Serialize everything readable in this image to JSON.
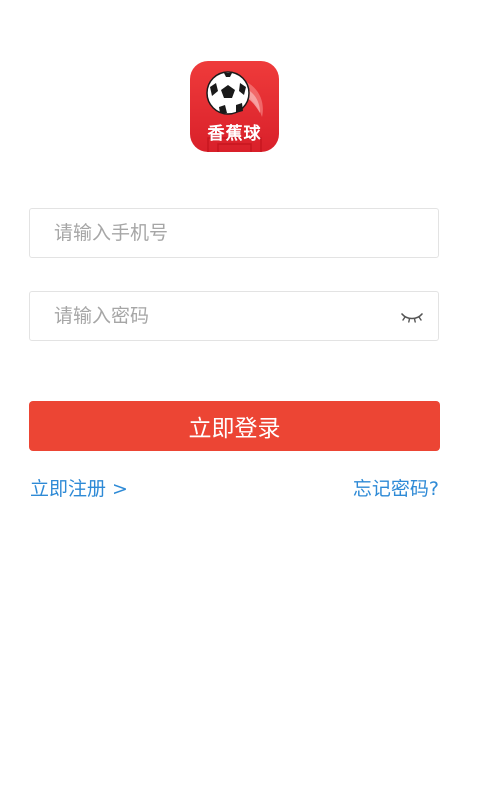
{
  "app": {
    "logo_text": "香蕉球",
    "logo_color": "#e3262f"
  },
  "form": {
    "phone_placeholder": "请输入手机号",
    "phone_value": "",
    "password_placeholder": "请输入密码",
    "password_value": "",
    "password_toggle_icon": "eye-closed-icon"
  },
  "actions": {
    "login_label": "立即登录",
    "login_color": "#ec4534",
    "register_label": "立即注册 >",
    "forgot_label": "忘记密码?",
    "link_color": "#2e8ad6"
  }
}
